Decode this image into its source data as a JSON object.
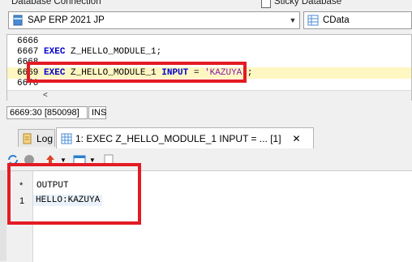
{
  "connection": {
    "label": "Database Connection",
    "value": "SAP ERP 2021 JP"
  },
  "database": {
    "sticky_label": "Sticky Database",
    "value": "CData"
  },
  "editor": {
    "lines": [
      {
        "num": "6666",
        "code": ""
      },
      {
        "num": "6667",
        "kw": "EXEC",
        "rest": " Z_HELLO_MODULE_1;"
      },
      {
        "num": "6668",
        "code": ""
      },
      {
        "num": "6669",
        "kw": "EXEC",
        "rest1": " Z_HELLO_MODULE_1 ",
        "kw2": "INPUT",
        "rest2": " = ",
        "str": "'KAZUYA'",
        "rest3": ";"
      },
      {
        "num": "6670",
        "code": ""
      }
    ],
    "scroll_left": "<"
  },
  "status": {
    "position": "6669:30 [850098]",
    "mode": "INS"
  },
  "tabs": [
    {
      "label": "Log"
    },
    {
      "label": "1: EXEC Z_HELLO_MODULE_1 INPUT = ... [1]",
      "close": "✕"
    }
  ],
  "results": {
    "header_marker": "*",
    "column": "OUTPUT",
    "rows": [
      {
        "index": "1",
        "value": "HELLO:KAZUYA"
      }
    ]
  },
  "colors": {
    "highlight": "#e31b23",
    "keyword": "#0000cc",
    "string": "#8a1aa8"
  },
  "icons": [
    "database-icon",
    "table-icon",
    "log-icon",
    "grid-tab-icon",
    "refresh-icon",
    "stop-icon",
    "export-icon",
    "layout-icon",
    "page-icon"
  ]
}
